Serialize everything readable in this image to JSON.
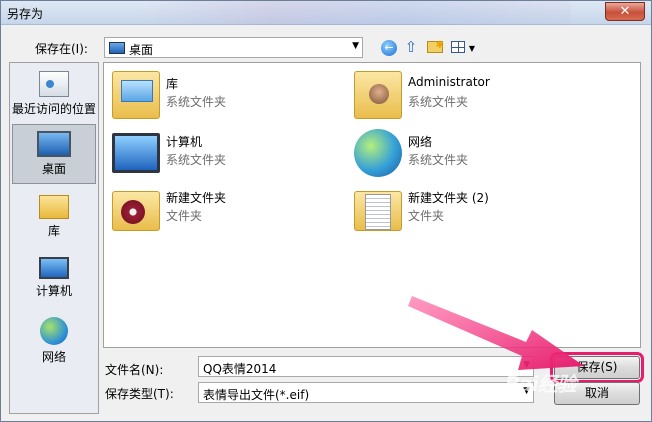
{
  "window": {
    "title": "另存为"
  },
  "toolbar": {
    "save_in_label": "保存在(I):",
    "location": "桌面",
    "back_icon": "back-arrow-icon",
    "up_icon": "up-folder-icon",
    "new_folder_icon": "new-folder-icon",
    "views_icon": "views-menu-icon"
  },
  "places": [
    {
      "label": "最近访问的位置",
      "icon": "recent-places-icon"
    },
    {
      "label": "桌面",
      "icon": "desktop-icon",
      "selected": true
    },
    {
      "label": "库",
      "icon": "libraries-icon"
    },
    {
      "label": "计算机",
      "icon": "computer-icon"
    },
    {
      "label": "网络",
      "icon": "network-icon"
    }
  ],
  "files": [
    {
      "name": "库",
      "type": "系统文件夹",
      "icon": "library-folder-icon"
    },
    {
      "name": "Administrator",
      "type": "系统文件夹",
      "icon": "user-folder-icon"
    },
    {
      "name": "计算机",
      "type": "系统文件夹",
      "icon": "computer-icon"
    },
    {
      "name": "网络",
      "type": "系统文件夹",
      "icon": "network-icon"
    },
    {
      "name": "新建文件夹",
      "type": "文件夹",
      "icon": "folder-icon"
    },
    {
      "name": "新建文件夹 (2)",
      "type": "文件夹",
      "icon": "folder-icon"
    }
  ],
  "footer": {
    "file_name_label": "文件名(N):",
    "file_name_value": "QQ表情2014",
    "file_type_label": "保存类型(T):",
    "file_type_value": "表情导出文件(*.eif)",
    "save_button": "保存(S)",
    "cancel_button": "取消"
  },
  "overlay": {
    "watermark": "Bai经验",
    "highlight_color": "#e61c6d"
  }
}
